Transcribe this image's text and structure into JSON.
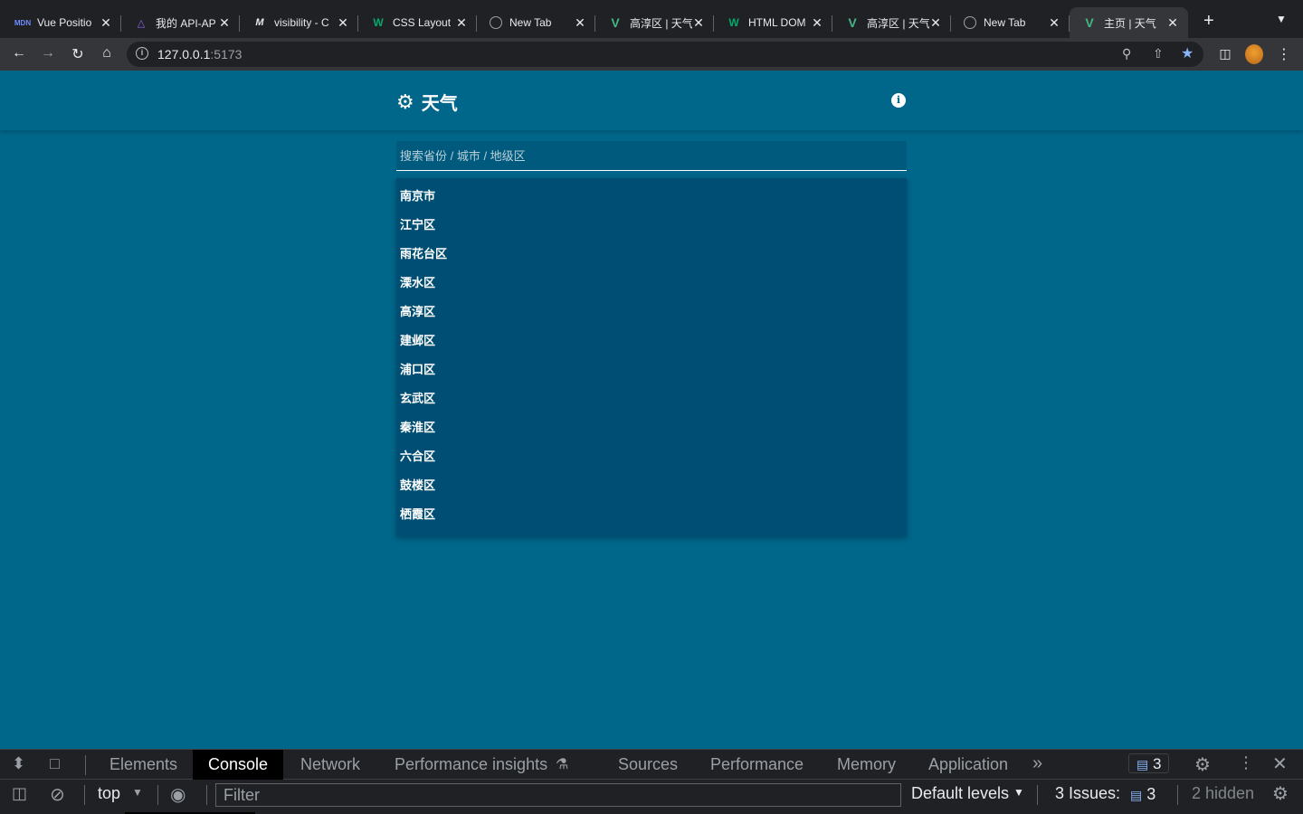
{
  "browser": {
    "tabs": [
      {
        "favicon": "mdn-icon",
        "title": "Vue Positio",
        "active": false
      },
      {
        "favicon": "api-icon",
        "title": "我的 API-AP",
        "active": false
      },
      {
        "favicon": "m-icon",
        "title": "visibility - C",
        "active": false
      },
      {
        "favicon": "w3schools-icon",
        "title": "CSS Layout",
        "active": false
      },
      {
        "favicon": "globe-icon",
        "title": "New Tab",
        "active": false
      },
      {
        "favicon": "vue-icon",
        "title": "高淳区 | 天气",
        "active": false
      },
      {
        "favicon": "w3schools-icon",
        "title": "HTML DOM",
        "active": false
      },
      {
        "favicon": "vue-icon",
        "title": "高淳区 | 天气",
        "active": false
      },
      {
        "favicon": "globe-icon",
        "title": "New Tab",
        "active": false
      },
      {
        "favicon": "vue-icon",
        "title": "主页 | 天气",
        "active": true
      }
    ],
    "new_tab_symbol": "+",
    "url_host": "127.0.0.1",
    "url_port": ":5173"
  },
  "app": {
    "brand": "天气",
    "search_placeholder": "搜索省份 / 城市 / 地级区",
    "results": [
      "南京市",
      "江宁区",
      "雨花台区",
      "溧水区",
      "高淳区",
      "建邺区",
      "浦口区",
      "玄武区",
      "秦淮区",
      "六合区",
      "鼓楼区",
      "栖霞区"
    ]
  },
  "devtools": {
    "tabs": {
      "elements": "Elements",
      "console": "Console",
      "network": "Network",
      "performance_insights": "Performance insights",
      "sources": "Sources",
      "performance": "Performance",
      "memory": "Memory",
      "application": "Application"
    },
    "messages_count": "3",
    "context": "top",
    "filter_placeholder": "Filter",
    "levels": "Default levels",
    "issues_label": "3 Issues:",
    "issues_count": "3",
    "hidden": "2 hidden"
  },
  "colors": {
    "page_bg": "#00668a",
    "dropdown_bg": "#004e73",
    "vue_green": "#42b883"
  }
}
